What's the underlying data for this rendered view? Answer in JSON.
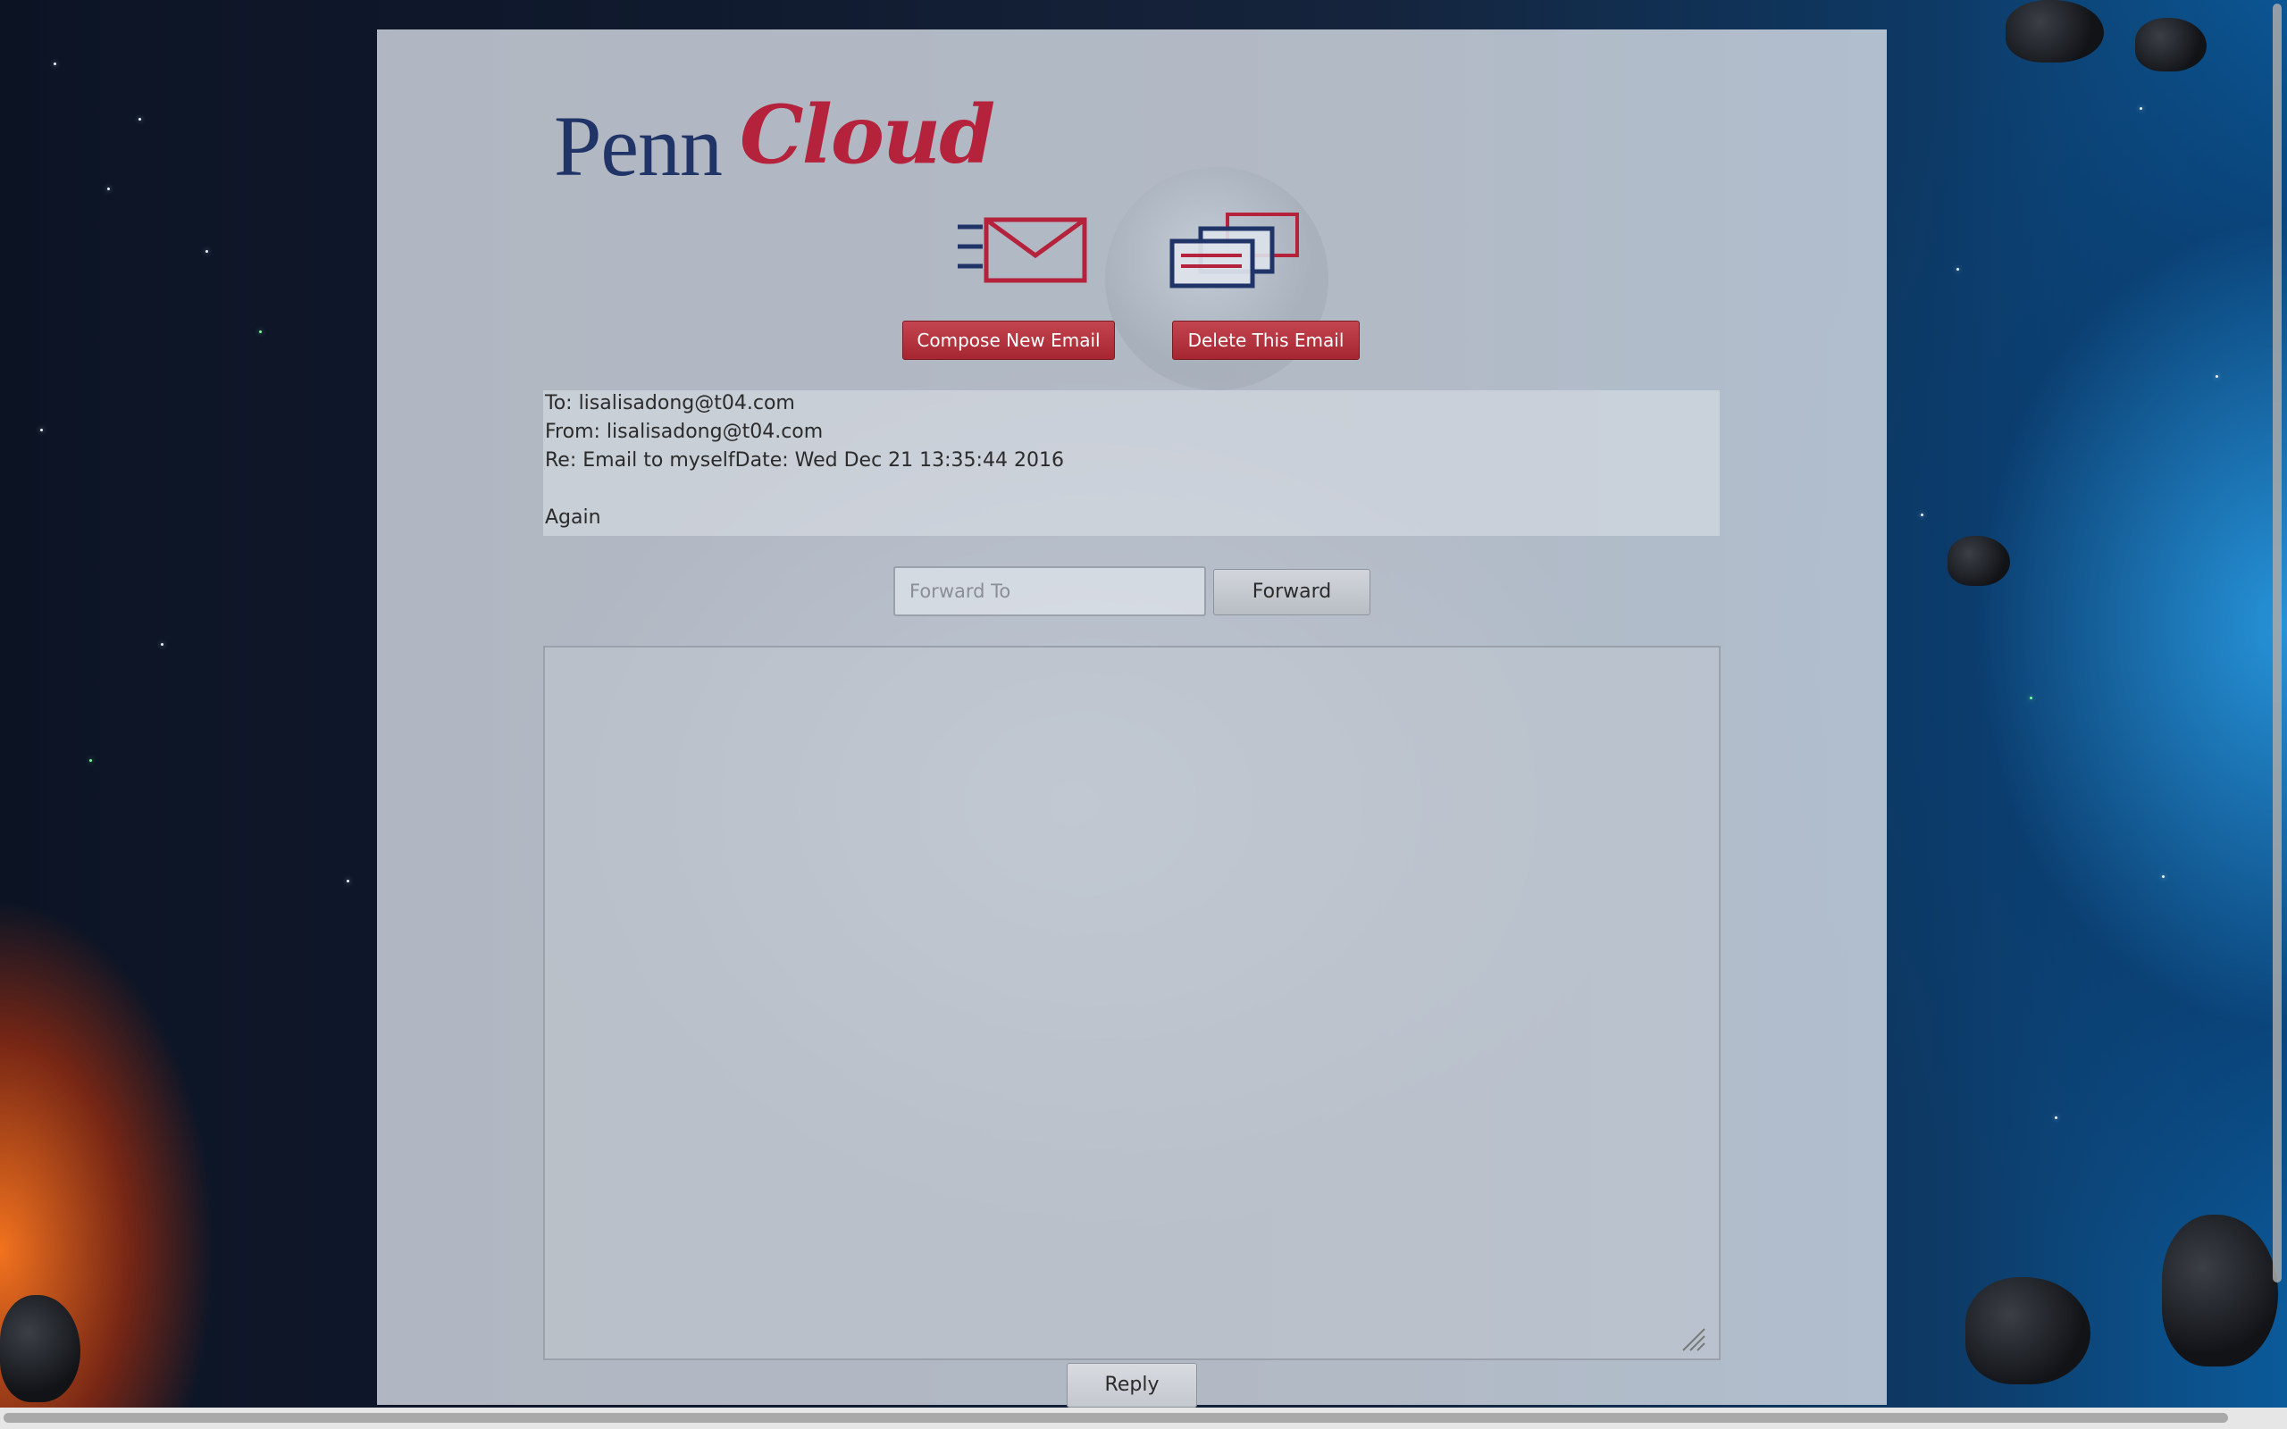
{
  "logo": {
    "penn": "Penn",
    "cloud": "Cloud"
  },
  "icons": {
    "compose": "envelope-send-icon",
    "inbox": "envelopes-stack-icon",
    "resize": "resize-grip-icon"
  },
  "toolbar": {
    "compose_label": "Compose New Email",
    "delete_label": "Delete This Email"
  },
  "email": {
    "to": "To: lisalisadong@t04.com",
    "from": "From: lisalisadong@t04.com",
    "re": "Re: Email to myselfDate: Wed Dec 21 13:35:44 2016",
    "body": "Again"
  },
  "forward": {
    "placeholder": "Forward To",
    "button_label": "Forward"
  },
  "reply": {
    "button_label": "Reply"
  },
  "colors": {
    "brand_blue": "#213468",
    "brand_red": "#b5223b",
    "button_red": "#a52630"
  }
}
